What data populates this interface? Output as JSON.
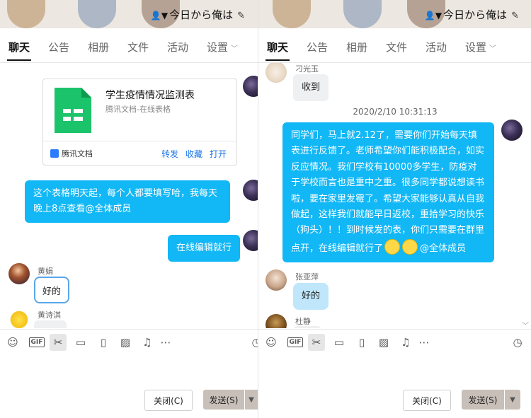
{
  "left": {
    "banner_title": "今日から俺は",
    "tabs": [
      "聊天",
      "公告",
      "相册",
      "文件",
      "活动",
      "设置"
    ],
    "card": {
      "title": "学生疫情情况监测表",
      "subtitle": "腾讯文档-在线表格",
      "brand": "腾讯文档",
      "actions": [
        "转发",
        "收藏",
        "打开"
      ]
    },
    "msg1": "这个表格明天起，每个人都要填写哈，我每天晚上8点查看@全体成员",
    "msg2": "在线编辑就行",
    "sender1": "黄娟",
    "sticker_text": "好的",
    "sender2": "黄诗淇",
    "buttons": {
      "close": "关闭(C)",
      "send": "发送(S)"
    }
  },
  "right": {
    "banner_title": "今日から俺は",
    "tabs": [
      "聊天",
      "公告",
      "相册",
      "文件",
      "活动",
      "设置"
    ],
    "sender_top": "刁光玉",
    "msg_top": "收到",
    "timestamp": "2020/2/10 10:31:13",
    "long_msg": "同学们，马上就2.12了，需要你们开始每天填表进行反馈了。老师希望你们能积极配合，如实反应情况。我们学校有10000多学生，防疫对于学校而言也是重中之重。很多同学都说想读书啦，要在家里发霉了。希望大家能够认真从自我做起，这样我们就能早日返校，重拾学习的快乐（狗头）！！到时候发的表，你们只需要在群里点开，在线编辑就行了",
    "long_msg_tail": "@全体成员",
    "sender3": "张亚萍",
    "sticker_text": "好的",
    "sender4": "杜静",
    "buttons": {
      "close": "关闭(C)",
      "send": "发送(S)"
    }
  },
  "toolbar_icons": [
    "smile-icon",
    "gif-icon",
    "scissors-icon",
    "folder-icon",
    "tablet-icon",
    "image-icon",
    "bell-off-icon",
    "more-icon",
    "clock-icon"
  ],
  "colors": {
    "bubble_blue": "#12b7f5",
    "banner": "#ece7e1",
    "send_button": "#c8bfb8"
  }
}
